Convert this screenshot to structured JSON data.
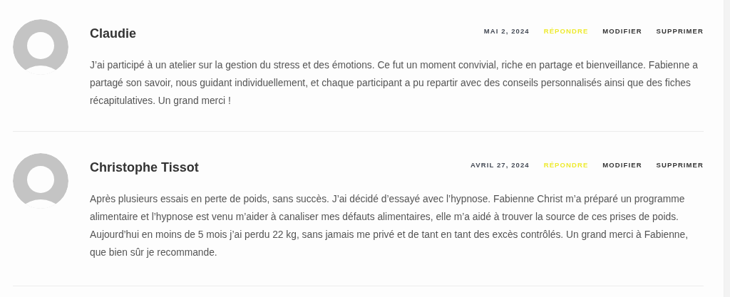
{
  "comments": [
    {
      "author": "Claudie",
      "date": "MAI 2, 2024",
      "actions": [
        {
          "kind": "reply",
          "label": "RÉPONDRE"
        },
        {
          "kind": "edit",
          "label": "MODIFIER"
        },
        {
          "kind": "delete",
          "label": "SUPPRIMER"
        }
      ],
      "text": "J’ai participé à un atelier sur la gestion du stress et des émotions. Ce fut un moment convivial, riche en partage et bienveillance. Fabienne a partagé son savoir, nous guidant individuellement, et chaque participant a pu repartir avec des conseils personnalisés ainsi que des fiches récapitulatives. Un grand merci !"
    },
    {
      "author": "Christophe Tissot",
      "date": "AVRIL 27, 2024",
      "actions": [
        {
          "kind": "reply",
          "label": "RÉPONDRE"
        },
        {
          "kind": "edit",
          "label": "MODIFIER"
        },
        {
          "kind": "delete",
          "label": "SUPPRIMER"
        }
      ],
      "text": "Après plusieurs essais en perte de poids, sans succès. J’ai décidé d’essayé avec l’hypnose. Fabienne Christ m’a préparé un programme alimentaire et l’hypnose est venu m’aider à canaliser mes défauts alimentaires, elle m’a aidé à trouver la source de ces prises de poids. Aujourd’hui en moins de 5 mois j’ai perdu 22 kg, sans jamais me privé et de tant en tant des excès contrôlés. Un grand merci à Fabienne, que bien sûr je recommande."
    }
  ]
}
